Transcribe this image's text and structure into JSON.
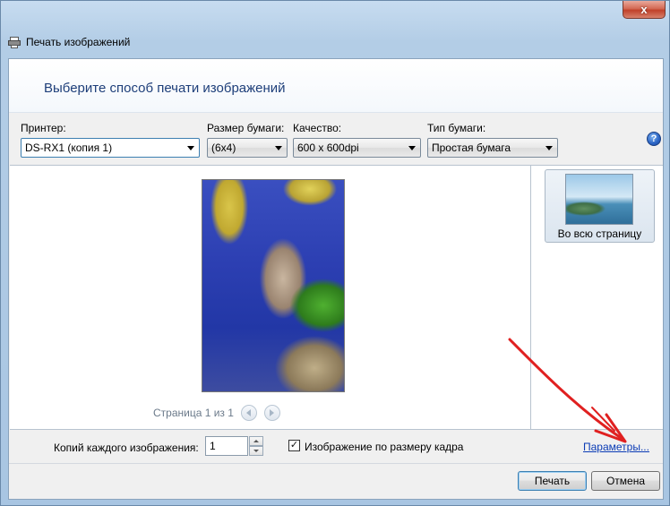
{
  "window": {
    "title": "Печать изображений",
    "close_label": "x"
  },
  "header": {
    "title": "Выберите способ печати изображений"
  },
  "controls": {
    "printer": {
      "label": "Принтер:",
      "value": "DS-RX1 (копия 1)"
    },
    "paper_size": {
      "label": "Размер бумаги:",
      "value": "(6x4)"
    },
    "quality": {
      "label": "Качество:",
      "value": "600 x 600dpi"
    },
    "paper_type": {
      "label": "Тип бумаги:",
      "value": "Простая бумага"
    },
    "help_label": "?"
  },
  "preview": {
    "page_text": "Страница 1 из 1"
  },
  "layouts": {
    "items": [
      {
        "label": "Во всю страницу"
      }
    ]
  },
  "bottom": {
    "copies_label": "Копий каждого изображения:",
    "copies_value": "1",
    "fit_checkbox_label": "Изображение по размеру кадра",
    "fit_checked_mark": "✓",
    "options_link": "Параметры..."
  },
  "buttons": {
    "print": "Печать",
    "cancel": "Отмена"
  },
  "colors": {
    "link": "#0a3bb5",
    "header_text": "#1e3f7a",
    "annotation_arrow": "#e02020"
  }
}
